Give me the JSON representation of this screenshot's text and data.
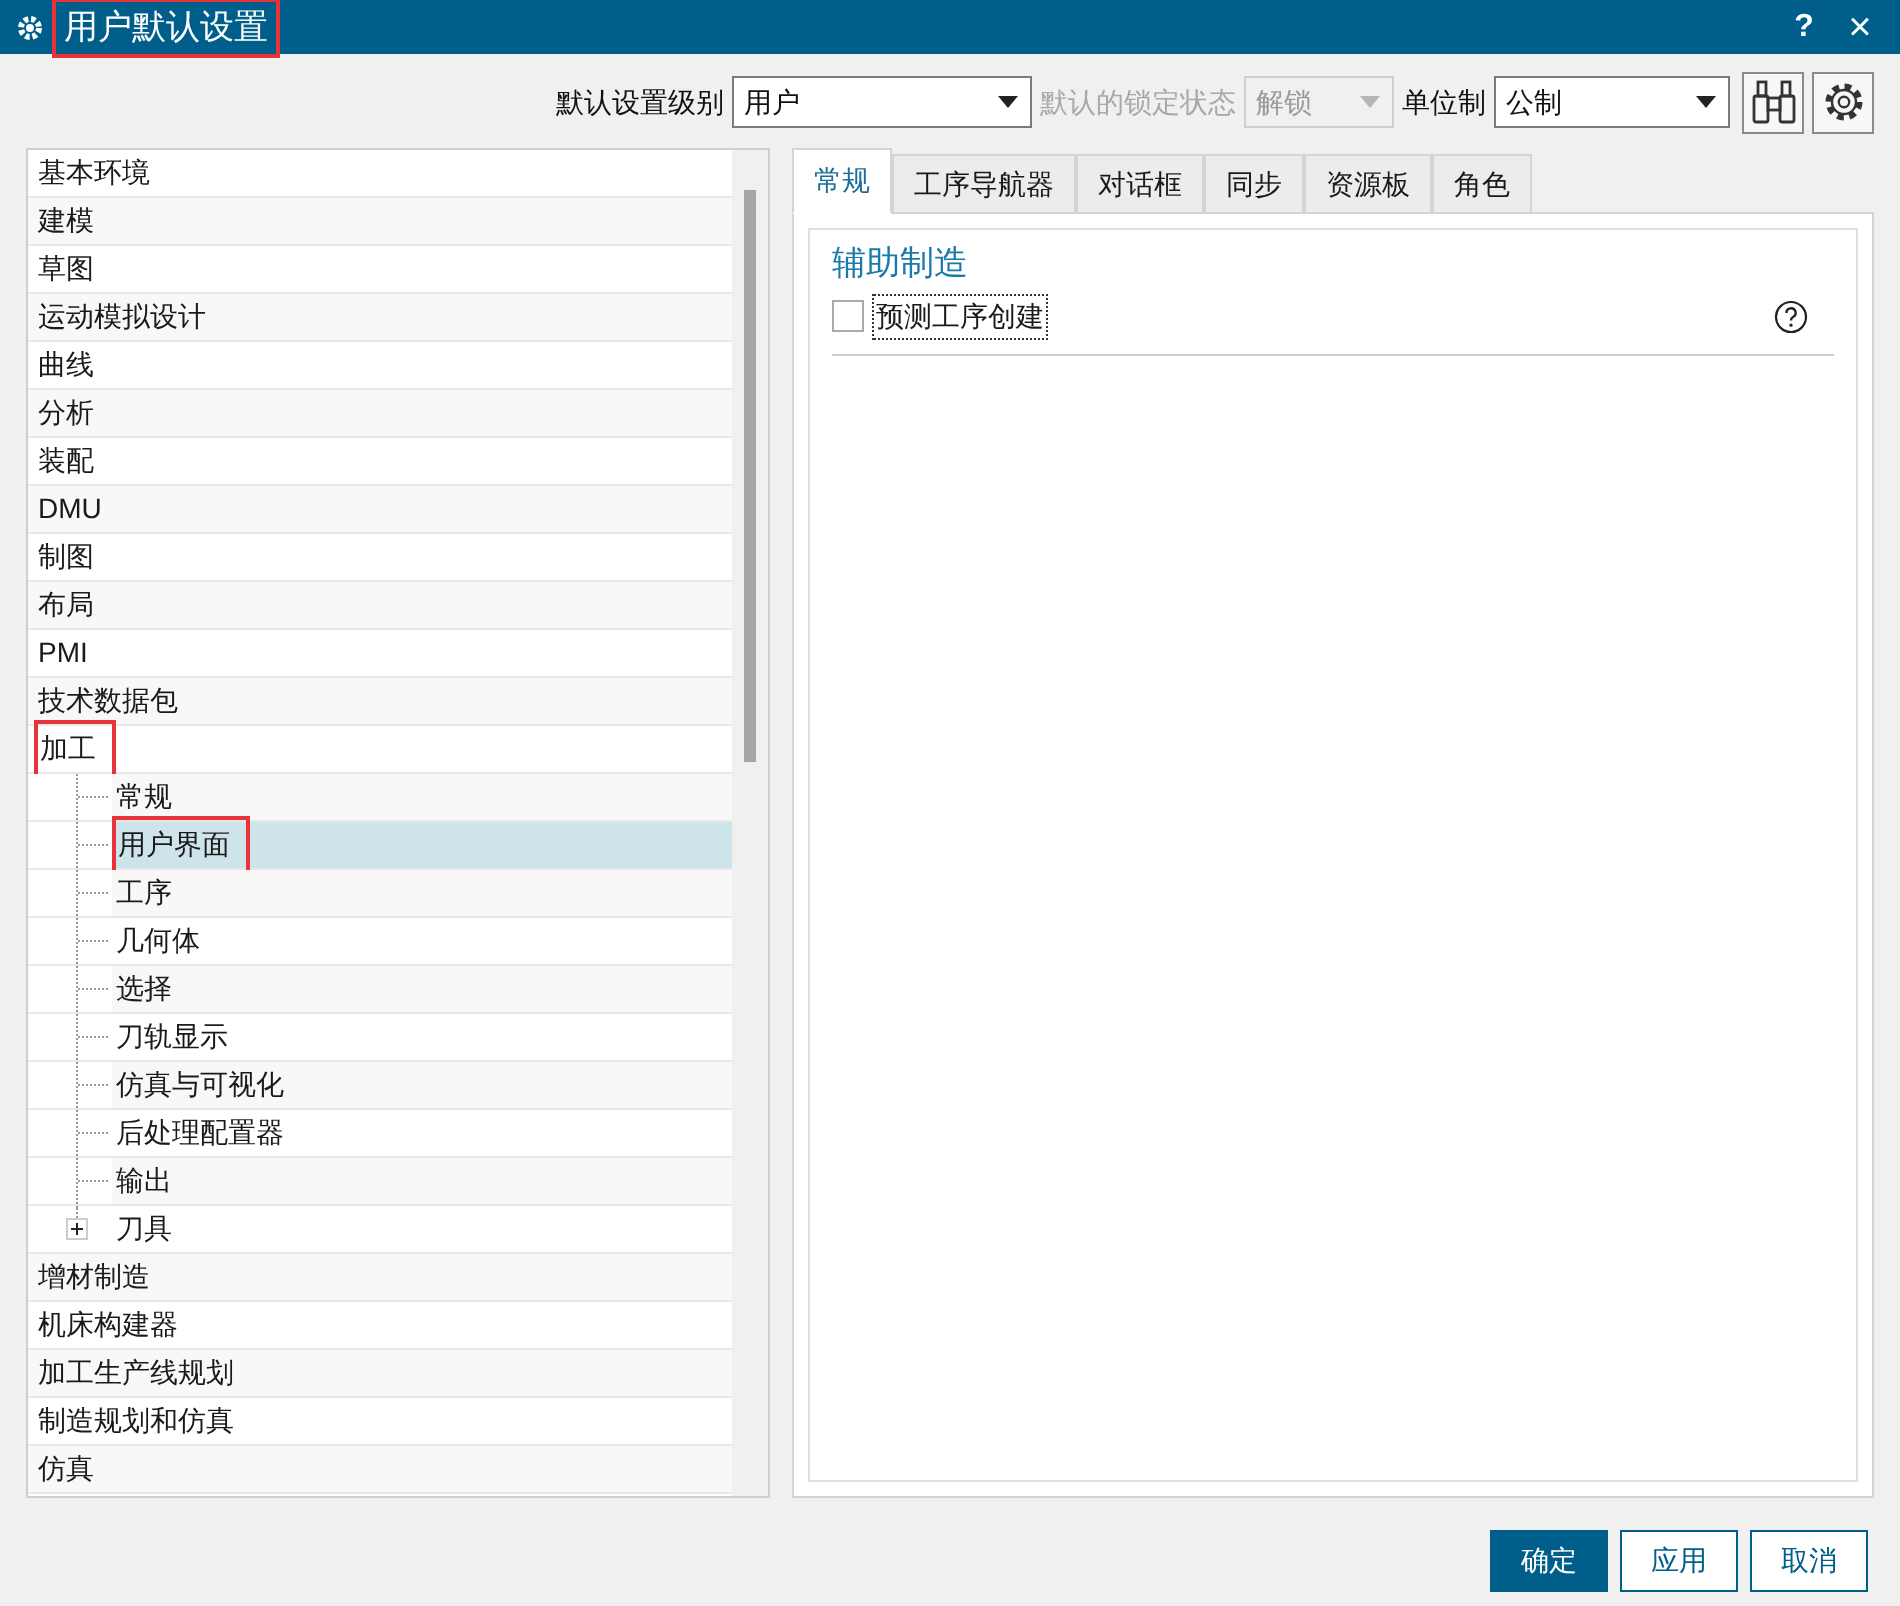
{
  "window": {
    "title": "用户默认设置",
    "title_marked": true,
    "help": "?",
    "close": "×"
  },
  "toolbar": [
    {
      "label": "默认设置级别",
      "value": "用户",
      "disabled": false
    },
    {
      "label": "默认的锁定状态",
      "value": "解锁",
      "disabled": true
    },
    {
      "label": "单位制",
      "value": "公制",
      "disabled": false
    }
  ],
  "tree": [
    {
      "label": "基本环境",
      "selected": false,
      "marked": false
    },
    {
      "label": "建模",
      "selected": false,
      "marked": false
    },
    {
      "label": "草图",
      "selected": false,
      "marked": false
    },
    {
      "label": "运动模拟设计",
      "selected": false,
      "marked": false
    },
    {
      "label": "曲线",
      "selected": false,
      "marked": false
    },
    {
      "label": "分析",
      "selected": false,
      "marked": false
    },
    {
      "label": "装配",
      "selected": false,
      "marked": false
    },
    {
      "label": "DMU",
      "selected": false,
      "marked": false
    },
    {
      "label": "制图",
      "selected": false,
      "marked": false
    },
    {
      "label": "布局",
      "selected": false,
      "marked": false
    },
    {
      "label": "PMI",
      "selected": false,
      "marked": false
    },
    {
      "label": "技术数据包",
      "selected": false,
      "marked": false
    },
    {
      "label": "加工",
      "selected": false,
      "marked": true,
      "children": [
        {
          "label": "常规",
          "selected": false,
          "marked": false,
          "kind": "leaf"
        },
        {
          "label": "用户界面",
          "selected": true,
          "marked": true,
          "kind": "leaf"
        },
        {
          "label": "工序",
          "selected": false,
          "marked": false,
          "kind": "leaf"
        },
        {
          "label": "几何体",
          "selected": false,
          "marked": false,
          "kind": "leaf"
        },
        {
          "label": "选择",
          "selected": false,
          "marked": false,
          "kind": "leaf"
        },
        {
          "label": "刀轨显示",
          "selected": false,
          "marked": false,
          "kind": "leaf"
        },
        {
          "label": "仿真与可视化",
          "selected": false,
          "marked": false,
          "kind": "leaf"
        },
        {
          "label": "后处理配置器",
          "selected": false,
          "marked": false,
          "kind": "leaf"
        },
        {
          "label": "输出",
          "selected": false,
          "marked": false,
          "kind": "leaf"
        },
        {
          "label": "刀具",
          "selected": false,
          "marked": false,
          "kind": "folder"
        }
      ]
    },
    {
      "label": "增材制造",
      "selected": false,
      "marked": false
    },
    {
      "label": "机床构建器",
      "selected": false,
      "marked": false
    },
    {
      "label": "加工生产线规划",
      "selected": false,
      "marked": false
    },
    {
      "label": "制造规划和仿真",
      "selected": false,
      "marked": false
    },
    {
      "label": "仿真",
      "selected": false,
      "marked": false
    }
  ],
  "tabs": [
    {
      "label": "常规",
      "selected": true
    },
    {
      "label": "工序导航器",
      "selected": false
    },
    {
      "label": "对话框",
      "selected": false
    },
    {
      "label": "同步",
      "selected": false
    },
    {
      "label": "资源板",
      "selected": false
    },
    {
      "label": "角色",
      "selected": false
    }
  ],
  "section": {
    "heading": "辅助制造",
    "options": [
      {
        "label": "预测工序创建",
        "checked": false,
        "focused": true
      }
    ]
  },
  "buttons": [
    {
      "label": "确定",
      "primary": true
    },
    {
      "label": "应用",
      "primary": false
    },
    {
      "label": "取消",
      "primary": false
    }
  ]
}
